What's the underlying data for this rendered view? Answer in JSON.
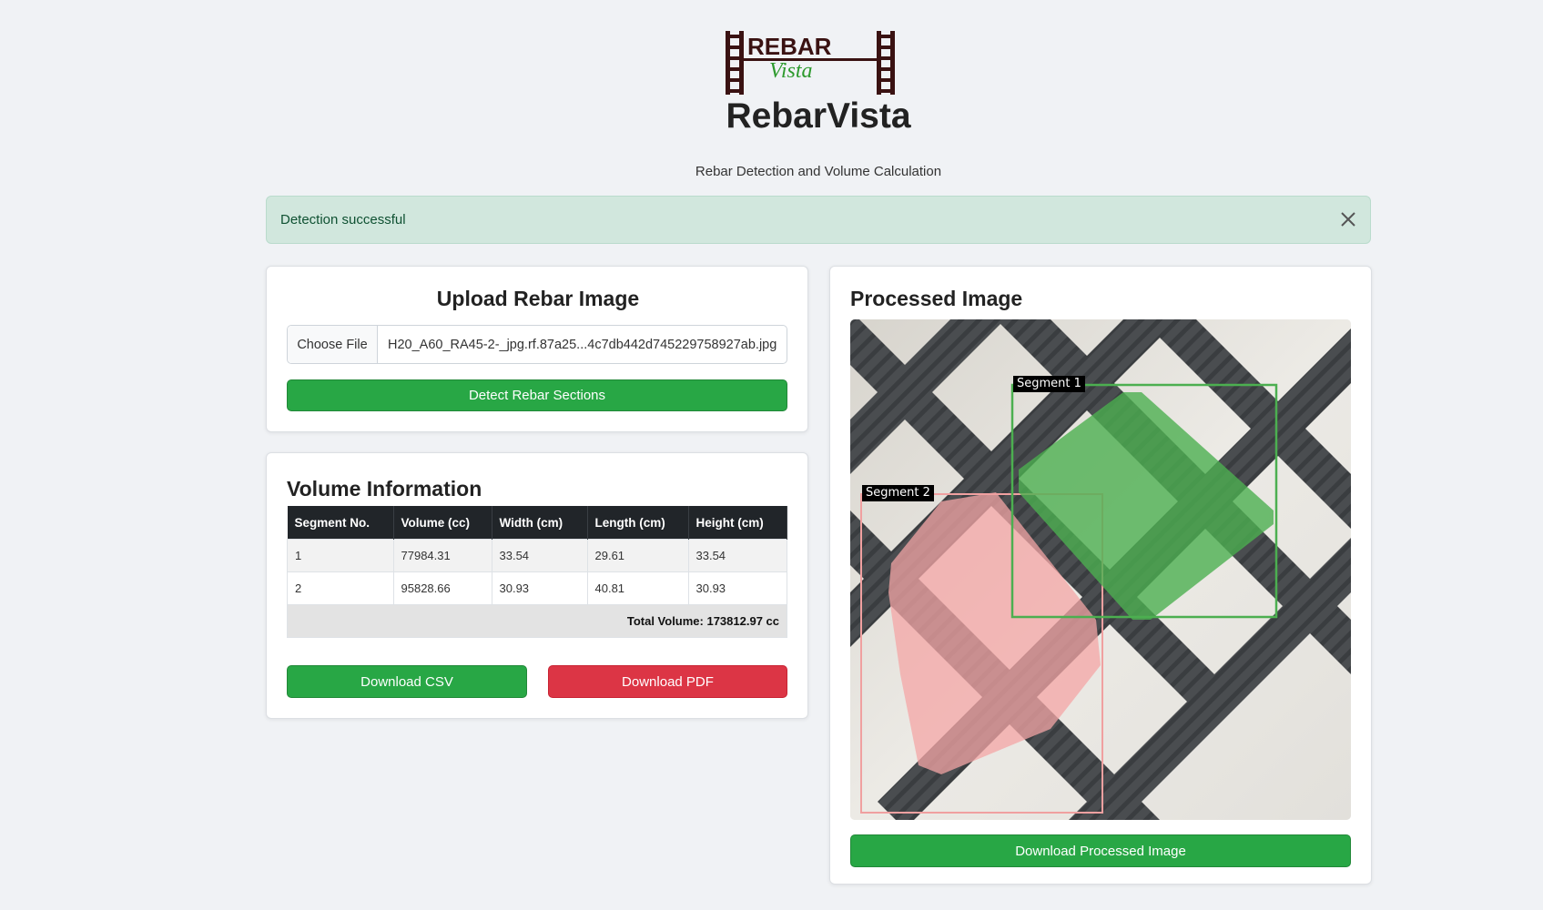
{
  "app": {
    "logo_text_top": "REBAR",
    "logo_text_bottom": "Vista",
    "title": "RebarVista",
    "subtitle": "Rebar Detection and Volume Calculation"
  },
  "alert": {
    "message": "Detection successful",
    "close_icon": "close-icon"
  },
  "upload": {
    "title": "Upload Rebar Image",
    "choose_file_label": "Choose File",
    "file_name": "H20_A60_RA45-2-_jpg.rf.87a25...4c7db442d745229758927ab.jpg",
    "detect_button": "Detect Rebar Sections"
  },
  "volume": {
    "title": "Volume Information",
    "columns": [
      "Segment No.",
      "Volume (cc)",
      "Width (cm)",
      "Length (cm)",
      "Height (cm)"
    ],
    "rows": [
      [
        "1",
        "77984.31",
        "33.54",
        "29.61",
        "33.54"
      ],
      [
        "2",
        "95828.66",
        "30.93",
        "40.81",
        "30.93"
      ]
    ],
    "total": "Total Volume: 173812.97 cc",
    "download_csv": "Download CSV",
    "download_pdf": "Download PDF"
  },
  "processed": {
    "title": "Processed Image",
    "segments": [
      "Segment 1",
      "Segment 2"
    ],
    "download_button": "Download Processed Image"
  },
  "colors": {
    "success": "#28a745",
    "danger": "#dc3545",
    "alert_bg": "#d1e7dd",
    "segment_1": "#4caf50",
    "segment_2": "#f4a6a6"
  }
}
